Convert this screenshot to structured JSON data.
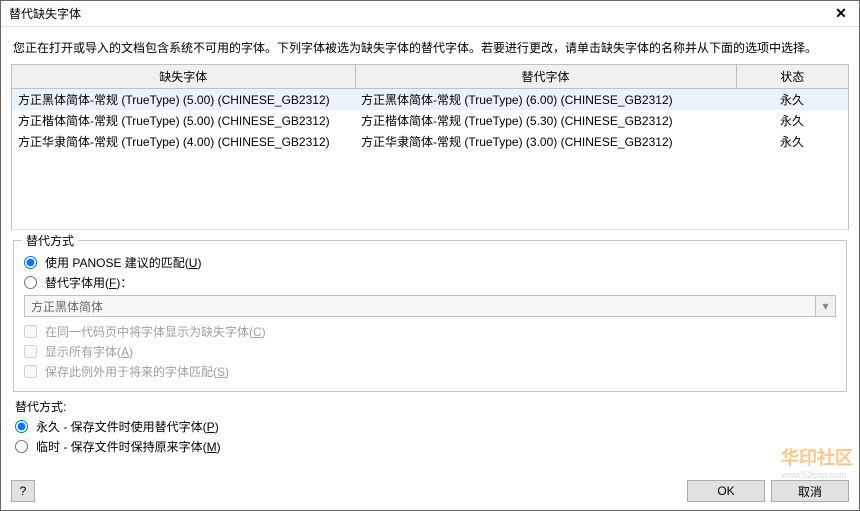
{
  "window": {
    "title": "替代缺失字体",
    "close_icon": "✕"
  },
  "description": "您正在打开或导入的文档包含系统不可用的字体。下列字体被选为缺失字体的替代字体。若要进行更改，请单击缺失字体的名称并从下面的选项中选择。",
  "table": {
    "headers": {
      "missing": "缺失字体",
      "substitute": "替代字体",
      "status": "状态"
    },
    "rows": [
      {
        "missing": "方正黑体简体-常规 (TrueType) (5.00) (CHINESE_GB2312)",
        "substitute": "方正黑体简体-常规 (TrueType) (6.00) (CHINESE_GB2312)",
        "status": "永久",
        "selected": true
      },
      {
        "missing": "方正楷体简体-常规 (TrueType) (5.00) (CHINESE_GB2312)",
        "substitute": "方正楷体简体-常规 (TrueType) (5.30) (CHINESE_GB2312)",
        "status": "永久",
        "selected": false
      },
      {
        "missing": "方正华隶简体-常规 (TrueType) (4.00) (CHINESE_GB2312)",
        "substitute": "方正华隶简体-常规 (TrueType) (3.00) (CHINESE_GB2312)",
        "status": "永久",
        "selected": false
      }
    ]
  },
  "group1": {
    "legend": "替代方式",
    "opt_panose": {
      "label": "使用 PANOSE 建议的匹配(",
      "hotkey": "U",
      "tail": ")",
      "checked": true
    },
    "opt_font": {
      "label": "替代字体用(",
      "hotkey": "F",
      "tail": ")：",
      "checked": false
    },
    "combo_value": "方正黑体简体",
    "chk_same_codepage": {
      "label": "在同一代码页中将字体显示为缺失字体(",
      "hotkey": "C",
      "tail": ")",
      "enabled": false
    },
    "chk_show_all": {
      "label": "显示所有字体(",
      "hotkey": "A",
      "tail": ")",
      "enabled": false
    },
    "chk_save_exception": {
      "label": "保存此例外用于将来的字体匹配(",
      "hotkey": "S",
      "tail": ")",
      "enabled": false
    }
  },
  "group2": {
    "label": "替代方式:",
    "opt_perm": {
      "label": "永久 - 保存文件时使用替代字体(",
      "hotkey": "P",
      "tail": ")",
      "checked": true
    },
    "opt_temp": {
      "label": "临时 - 保存文件时保持原来字体(",
      "hotkey": "M",
      "tail": ")",
      "checked": false
    }
  },
  "footer": {
    "help": "?",
    "ok": "OK",
    "cancel": "取消"
  },
  "watermark": {
    "line1": "华印社区",
    "line2": "www.52cnp.com"
  }
}
